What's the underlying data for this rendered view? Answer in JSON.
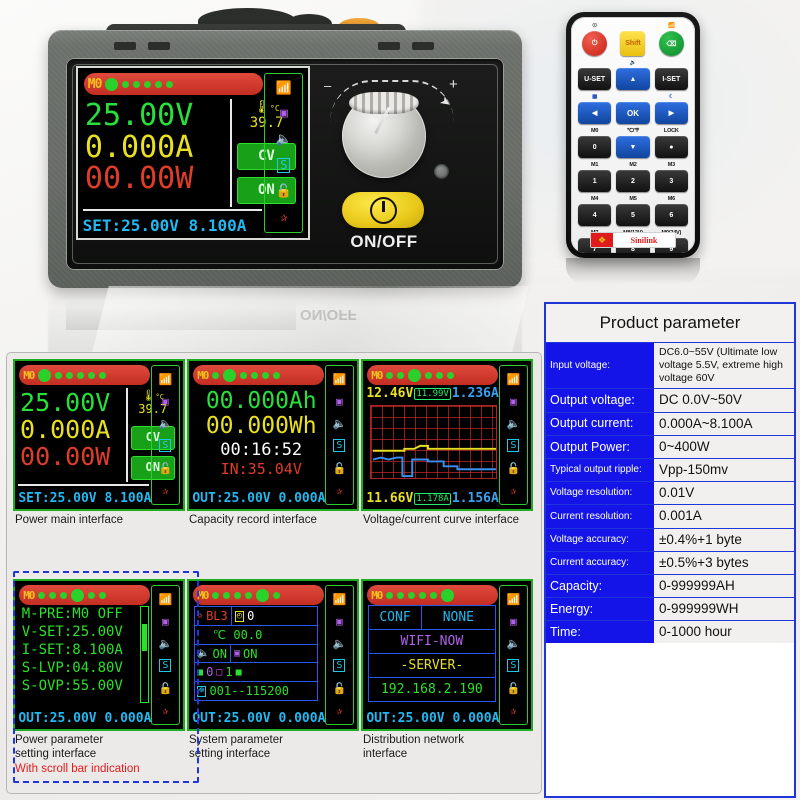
{
  "device": {
    "onoff_label": "ON/OFF",
    "knob_minus": "–",
    "knob_plus": "+",
    "screen": {
      "model": "M0",
      "voltage": "25.00V",
      "current": "0.000A",
      "power": "00.00W",
      "temp_unit": "°C",
      "temp_value": "39.7",
      "mode_badge": "CV",
      "output_badge": "ON",
      "set_line": "SET:25.00V 8.100A"
    }
  },
  "remote": {
    "keys": {
      "power": "",
      "shift": "Shift",
      "wifi": "",
      "uset": "U-SET",
      "up": "▲",
      "iset": "I-SET",
      "left": "◀",
      "ok": "OK",
      "right": "▶",
      "zero": "0",
      "down": "▼",
      "dot": "●",
      "one": "1",
      "two": "2",
      "three": "3",
      "four": "4",
      "five": "5",
      "six": "6",
      "seven": "7",
      "eight": "8",
      "nine": "9"
    },
    "tags": {
      "speaker": "",
      "display": "",
      "moon": "",
      "m0": "M0",
      "degc": "℃/℉",
      "lock": "LOCK",
      "m1": "M1",
      "m2": "M2",
      "m3": "M3",
      "m4": "M4",
      "m5": "M5",
      "m6": "M6",
      "m7": "M7",
      "m8": "M8(12V)",
      "m9": "M9(24V)"
    },
    "brand": "Sinilink"
  },
  "gallery": {
    "captions": {
      "power_main": "Power main interface",
      "capacity": "Capacity record interface",
      "curve": "Voltage/current curve interface",
      "power_param_1": "Power parameter",
      "power_param_2": "setting interface",
      "power_param_note": "With scroll bar indication",
      "system_param_1": "System parameter",
      "system_param_2": "setting interface",
      "network_1": "Distribution network",
      "network_2": "interface"
    },
    "power_main": {
      "model": "M0",
      "voltage": "25.00V",
      "current": "0.000A",
      "power": "00.00W",
      "temp_unit": "°C",
      "temp_value": "39.7",
      "mode_badge": "CV",
      "output_badge": "ON",
      "set_line": "SET:25.00V 8.100A"
    },
    "capacity": {
      "model": "M0",
      "ah": "00.000Ah",
      "wh": "00.000Wh",
      "time": "00:16:52",
      "input": "IN:35.04V",
      "out_line": "OUT:25.00V 0.000A"
    },
    "curve": {
      "model": "M0",
      "top_left": "12.46V",
      "top_mid": "11.99V",
      "top_right": "1.236A",
      "bottom_left": "11.66V",
      "bottom_mid": "1.178A",
      "bottom_right": "1.156A"
    },
    "power_param": {
      "model": "M0",
      "lines": [
        "M-PRE:M0 OFF",
        "V-SET:25.00V",
        "I-SET:8.100A",
        "S-LVP:04.80V",
        "S-OVP:55.00V"
      ],
      "out_line": "OUT:25.00V 0.000A"
    },
    "system_param": {
      "model": "M0",
      "backlight": "BL3",
      "clock_value": "0",
      "temp": "℃ 00.0",
      "sound": "ON",
      "display": "ON",
      "mem_a": "0",
      "mem_b": "1",
      "comm": "001--115200",
      "out_line": "OUT:25.00V 0.000A"
    },
    "network": {
      "model": "M0",
      "conf_label": "CONF",
      "conf_value": "NONE",
      "wifi_line": "WIFI-NOW",
      "server_line": "-SERVER-",
      "ip": "192.168.2.190",
      "out_line": "OUT:25.00V 0.000A"
    }
  },
  "spec": {
    "title": "Product parameter",
    "rows": [
      {
        "key": "Input voltage:",
        "value": "DC6.0~55V (Ultimate low voltage 5.5V, extreme high voltage 60V",
        "small": true
      },
      {
        "key": "Output voltage:",
        "value": "DC 0.0V~50V"
      },
      {
        "key": "Output current:",
        "value": "0.000A~8.100A"
      },
      {
        "key": "Output Power:",
        "value": "0~400W"
      },
      {
        "key": "Typical output ripple:",
        "value": "Vpp-150mv",
        "smallkey": true
      },
      {
        "key": "Voltage resolution:",
        "value": "0.01V",
        "smallkey": true
      },
      {
        "key": "Current resolution:",
        "value": "0.001A",
        "smallkey": true
      },
      {
        "key": "Voltage accuracy:",
        "value": "±0.4%+1 byte",
        "smallkey": true
      },
      {
        "key": "Current accuracy:",
        "value": "±0.5%+3 bytes",
        "smallkey": true
      },
      {
        "key": "Capacity:",
        "value": "0-999999AH"
      },
      {
        "key": "Energy:",
        "value": "0-999999WH"
      },
      {
        "key": "Time:",
        "value": "0-1000 hour"
      }
    ]
  },
  "colors": {
    "voltage_green": "#27e03a",
    "current_yellow": "#e8e020",
    "power_red": "#e03c2a",
    "set_blue": "#23b8f0",
    "topbar_red": "#c22e22",
    "spec_blue": "#1414e8",
    "accent_dashed": "#2036d8"
  }
}
